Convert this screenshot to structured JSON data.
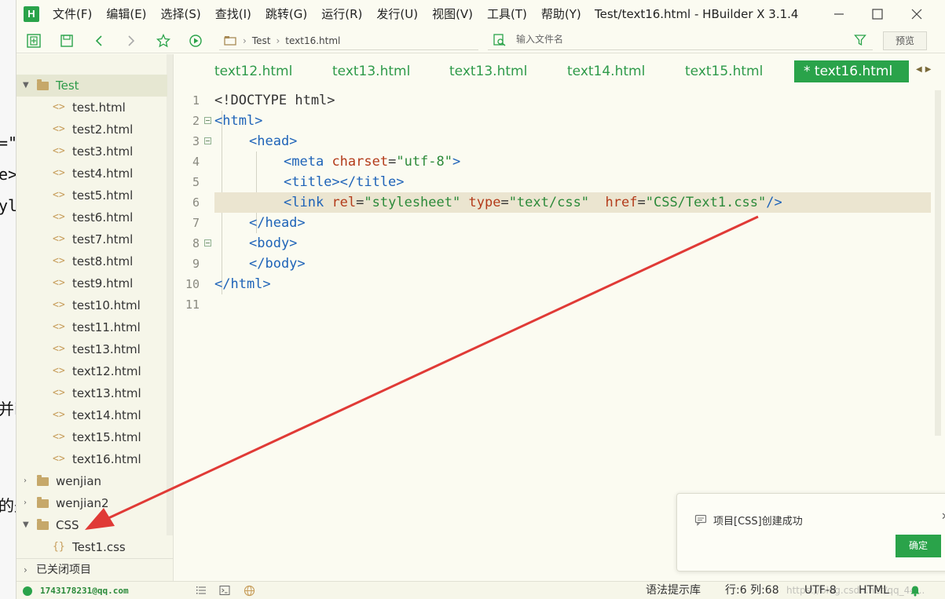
{
  "app": {
    "window_title": "Test/text16.html - HBuilder X 3.1.4",
    "logo_letter": "H"
  },
  "menu": [
    "文件(F)",
    "编辑(E)",
    "选择(S)",
    "查找(I)",
    "跳转(G)",
    "运行(R)",
    "发行(U)",
    "视图(V)",
    "工具(T)",
    "帮助(Y)"
  ],
  "background_fragments": [
    "=\"",
    "e>",
    "yl",
    "并i",
    "的是"
  ],
  "toolbar": {
    "breadcrumb": [
      "Test",
      "text16.html"
    ],
    "file_search_placeholder": "输入文件名",
    "preview_label": "预览"
  },
  "sidebar": {
    "project_test": "Test",
    "test_files": [
      "test.html",
      "test2.html",
      "test3.html",
      "test4.html",
      "test5.html",
      "test6.html",
      "test7.html",
      "test8.html",
      "test9.html",
      "test10.html",
      "test11.html",
      "test13.html",
      "text12.html",
      "text13.html",
      "text14.html",
      "text15.html",
      "text16.html"
    ],
    "project_wenjian": "wenjian",
    "project_wenjian2": "wenjian2",
    "project_css": "CSS",
    "css_files": [
      "Test1.css"
    ],
    "closed_projects": "已关闭项目",
    "file_icon": "<>",
    "css_icon": "{}"
  },
  "tabs": [
    "text12.html",
    "text13.html",
    "text13.html",
    "text14.html",
    "text15.html",
    "* text16.html"
  ],
  "editor": {
    "line_numbers": [
      "1",
      "2",
      "3",
      "4",
      "5",
      "6",
      "7",
      "8",
      "9",
      "10",
      "11"
    ],
    "current_line": 6,
    "code": {
      "l1": "<!DOCTYPE html>",
      "l2_tag": "<html>",
      "l3_tag": "<head>",
      "l4_tag_open": "<meta",
      "l4_attr": "charset",
      "l4_eq": "=",
      "l4_val": "\"utf-8\"",
      "l4_close": ">",
      "l5": "<title></title>",
      "l6_tag_open": "<link",
      "l6_attr1": "rel",
      "l6_val1": "\"stylesheet\"",
      "l6_attr2": "type",
      "l6_val2": "\"text/css\"",
      "l6_attr3": "href",
      "l6_val3": "\"CSS/Text1.css\"",
      "l6_close": "/>",
      "eq": "=",
      "l7": "</head>",
      "l8": "<body>",
      "l9": "</body>",
      "l10": "</html>"
    }
  },
  "notification": {
    "message": "项目[CSS]创建成功",
    "ok_label": "确定"
  },
  "statusbar": {
    "user": "1743178231@qq.com",
    "syntax_lib": "语法提示库",
    "position": "行:6  列:68",
    "encoding": "UTF-8",
    "language": "HTML",
    "watermark": "https://blog.csdn.net/qq_44..."
  },
  "colors": {
    "accent": "#2aa34a",
    "tag": "#1e63b8",
    "attr": "#b33b1a",
    "string": "#2c8a3a",
    "annotation_arrow": "#e03a36"
  }
}
